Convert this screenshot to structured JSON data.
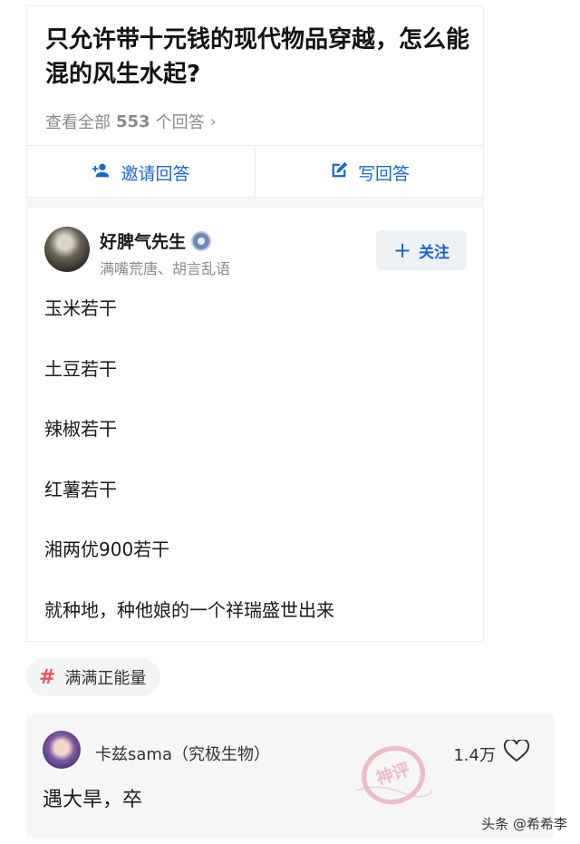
{
  "question": {
    "title": "只允许带十元钱的现代物品穿越，怎么能混的风生水起?",
    "view_all_prefix": "查看全部",
    "answer_count": "553",
    "view_all_suffix": "个回答",
    "chevron": "›"
  },
  "actions": {
    "invite_label": "邀请回答",
    "write_label": "写回答",
    "invite_icon": "person-add-icon",
    "write_icon": "edit-icon",
    "accent_color": "#1769c9"
  },
  "answer": {
    "author_name": "好脾气先生",
    "author_bio": "满嘴荒唐、胡言乱语",
    "follow_label": "关注",
    "follow_icon": "+",
    "lines": [
      "玉米若干",
      "土豆若干",
      "辣椒若干",
      "红薯若干",
      "湘两优900若干",
      "就种地，种他娘的一个祥瑞盛世出来"
    ]
  },
  "tag": {
    "symbol": "#",
    "label": "满满正能量",
    "symbol_color": "#e6575f"
  },
  "comment": {
    "user": "卡兹sama（究极生物）",
    "likes": "1.4万",
    "text": "遇大旱，卒",
    "stamp_text": "神评"
  },
  "watermark": "头条 @希希李"
}
